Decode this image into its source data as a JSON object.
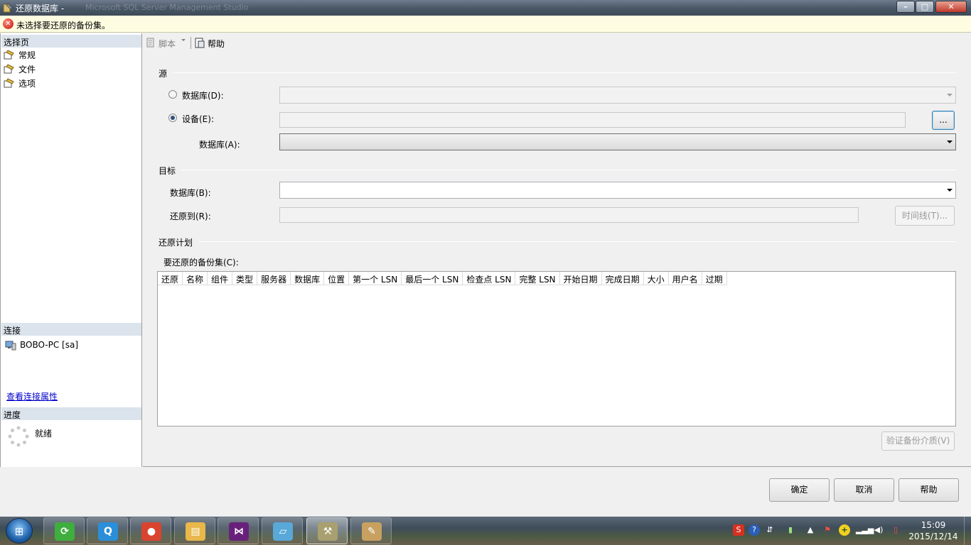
{
  "window": {
    "title": "还原数据库 -",
    "title_ghost": "Microsoft SQL Server Management Studio",
    "minimize": "–",
    "maximize": "□",
    "close": "✕"
  },
  "error": {
    "icon": "error-icon",
    "message": "未选择要还原的备份集。"
  },
  "sidebar": {
    "select_page_header": "选择页",
    "pages": [
      {
        "label": "常规",
        "icon": "page-icon"
      },
      {
        "label": "文件",
        "icon": "page-icon"
      },
      {
        "label": "选项",
        "icon": "page-icon"
      }
    ],
    "connection_header": "连接",
    "connection": "BOBO-PC [sa]",
    "view_connection_link": "查看连接属性",
    "progress_header": "进度",
    "progress_status": "就绪"
  },
  "toolbar": {
    "script_label": "脚本",
    "help_label": "帮助"
  },
  "source": {
    "group_title": "源",
    "database_radio_label": "数据库(D):",
    "device_radio_label": "设备(E):",
    "device_value": "",
    "browse_button": "...",
    "database_a_label": "数据库(A):",
    "database_a_value": "",
    "selected_option": "设备(E)"
  },
  "destination": {
    "group_title": "目标",
    "database_b_label": "数据库(B):",
    "database_b_value": "",
    "restore_to_label": "还原到(R):",
    "restore_to_value": "",
    "timeline_button": "时间线(T)..."
  },
  "restore_plan": {
    "group_title": "还原计划",
    "backup_sets_label": "要还原的备份集(C):",
    "columns": [
      "还原",
      "名称",
      "组件",
      "类型",
      "服务器",
      "数据库",
      "位置",
      "第一个 LSN",
      "最后一个 LSN",
      "检查点 LSN",
      "完整 LSN",
      "开始日期",
      "完成日期",
      "大小",
      "用户名",
      "过期"
    ],
    "rows": [],
    "verify_button": "验证备份介质(V)"
  },
  "footer": {
    "ok_button": "确定",
    "cancel_button": "取消",
    "help_button": "帮助"
  },
  "taskbar": {
    "apps": [
      {
        "name": "360-icon",
        "glyph": "⟳",
        "color": "#3fae3f"
      },
      {
        "name": "qq-browser-icon",
        "glyph": "Q",
        "color": "#2a8fd8"
      },
      {
        "name": "chrome-icon",
        "glyph": "●",
        "color": "#d9442f"
      },
      {
        "name": "explorer-icon",
        "glyph": "▤",
        "color": "#e8b84a"
      },
      {
        "name": "visual-studio-icon",
        "glyph": "⋈",
        "color": "#68217a"
      },
      {
        "name": "notepad-icon",
        "glyph": "▱",
        "color": "#58a8d8"
      },
      {
        "name": "ssms-icon",
        "glyph": "⚒",
        "color": "#a8a070"
      },
      {
        "name": "paint-icon",
        "glyph": "✎",
        "color": "#c8a060"
      }
    ],
    "time": "15:09",
    "date": "2015/12/14"
  }
}
